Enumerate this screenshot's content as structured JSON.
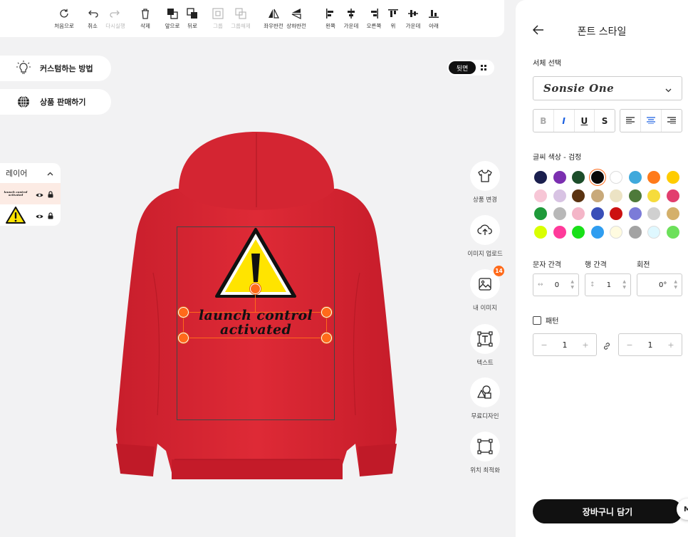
{
  "toolbar": {
    "reset": "처음으로",
    "undo": "취소",
    "redo": "다시실행",
    "delete": "삭제",
    "front": "앞으로",
    "back": "뒤로",
    "group": "그룹",
    "ungroup": "그룹해제",
    "flip_h": "좌우반전",
    "flip_v": "상하반전",
    "align_left": "왼쪽",
    "align_center": "가운데",
    "align_right": "오른쪽",
    "align_top": "위",
    "align_middle": "가운데",
    "align_bottom": "아래"
  },
  "left": {
    "howto": "커스텀하는 방법",
    "sell": "상품 판매하기"
  },
  "layers": {
    "title": "레이어",
    "thumb_text": "launch control activated"
  },
  "view": {
    "active": "뒷면"
  },
  "design": {
    "line1": "launch control",
    "line2": "activated"
  },
  "right_tools": {
    "change_product": "상품 변경",
    "upload_image": "이미지 업로드",
    "my_images": "내 이미지",
    "my_images_badge": "14",
    "text": "텍스트",
    "free_design": "무료디자인",
    "position_optimize": "위치 최적화"
  },
  "panel": {
    "title": "폰트 스타일",
    "font_select_label": "서체 선택",
    "font_name": "Sonsie One",
    "format": {
      "bold": "B",
      "italic": "I",
      "underline": "U",
      "strike": "S"
    },
    "color_label": "글씨 색상 - 검정",
    "swatches": [
      [
        "#1a1f4e",
        "#7b2fb0",
        "#1c4d2a",
        "#0a0a0a",
        "#ffffff",
        "#3fa9dc",
        "#ff7a1a",
        "#ffcc00"
      ],
      [
        "#f7c6d6",
        "#d8c3e3",
        "#5a3311",
        "#c8a97a",
        "#ece3c4",
        "#4e7a3a",
        "#f6dc3c",
        "#e23e6e"
      ],
      [
        "#1f9a3a",
        "#b8b8b8",
        "#f4b6c8",
        "#3a4fb8",
        "#cc1111",
        "#7b7bd8",
        "#d0d0d0",
        "#d4b06a"
      ],
      [
        "#d9ff00",
        "#ff3a9a",
        "#19e019",
        "#2f9df0",
        "#fffbe0",
        "#a3a3a3",
        "#dff8ff",
        "#6ce05a"
      ]
    ],
    "selected_color": "#0a0a0a",
    "letter_spacing_label": "문자 간격",
    "line_spacing_label": "행 간격",
    "rotation_label": "회전",
    "letter_spacing": "0",
    "line_spacing": "1",
    "rotation": "0°",
    "pattern_label": "패턴",
    "pattern_x": "1",
    "pattern_y": "1",
    "cart": "장바구니 담기",
    "chat": "M"
  }
}
